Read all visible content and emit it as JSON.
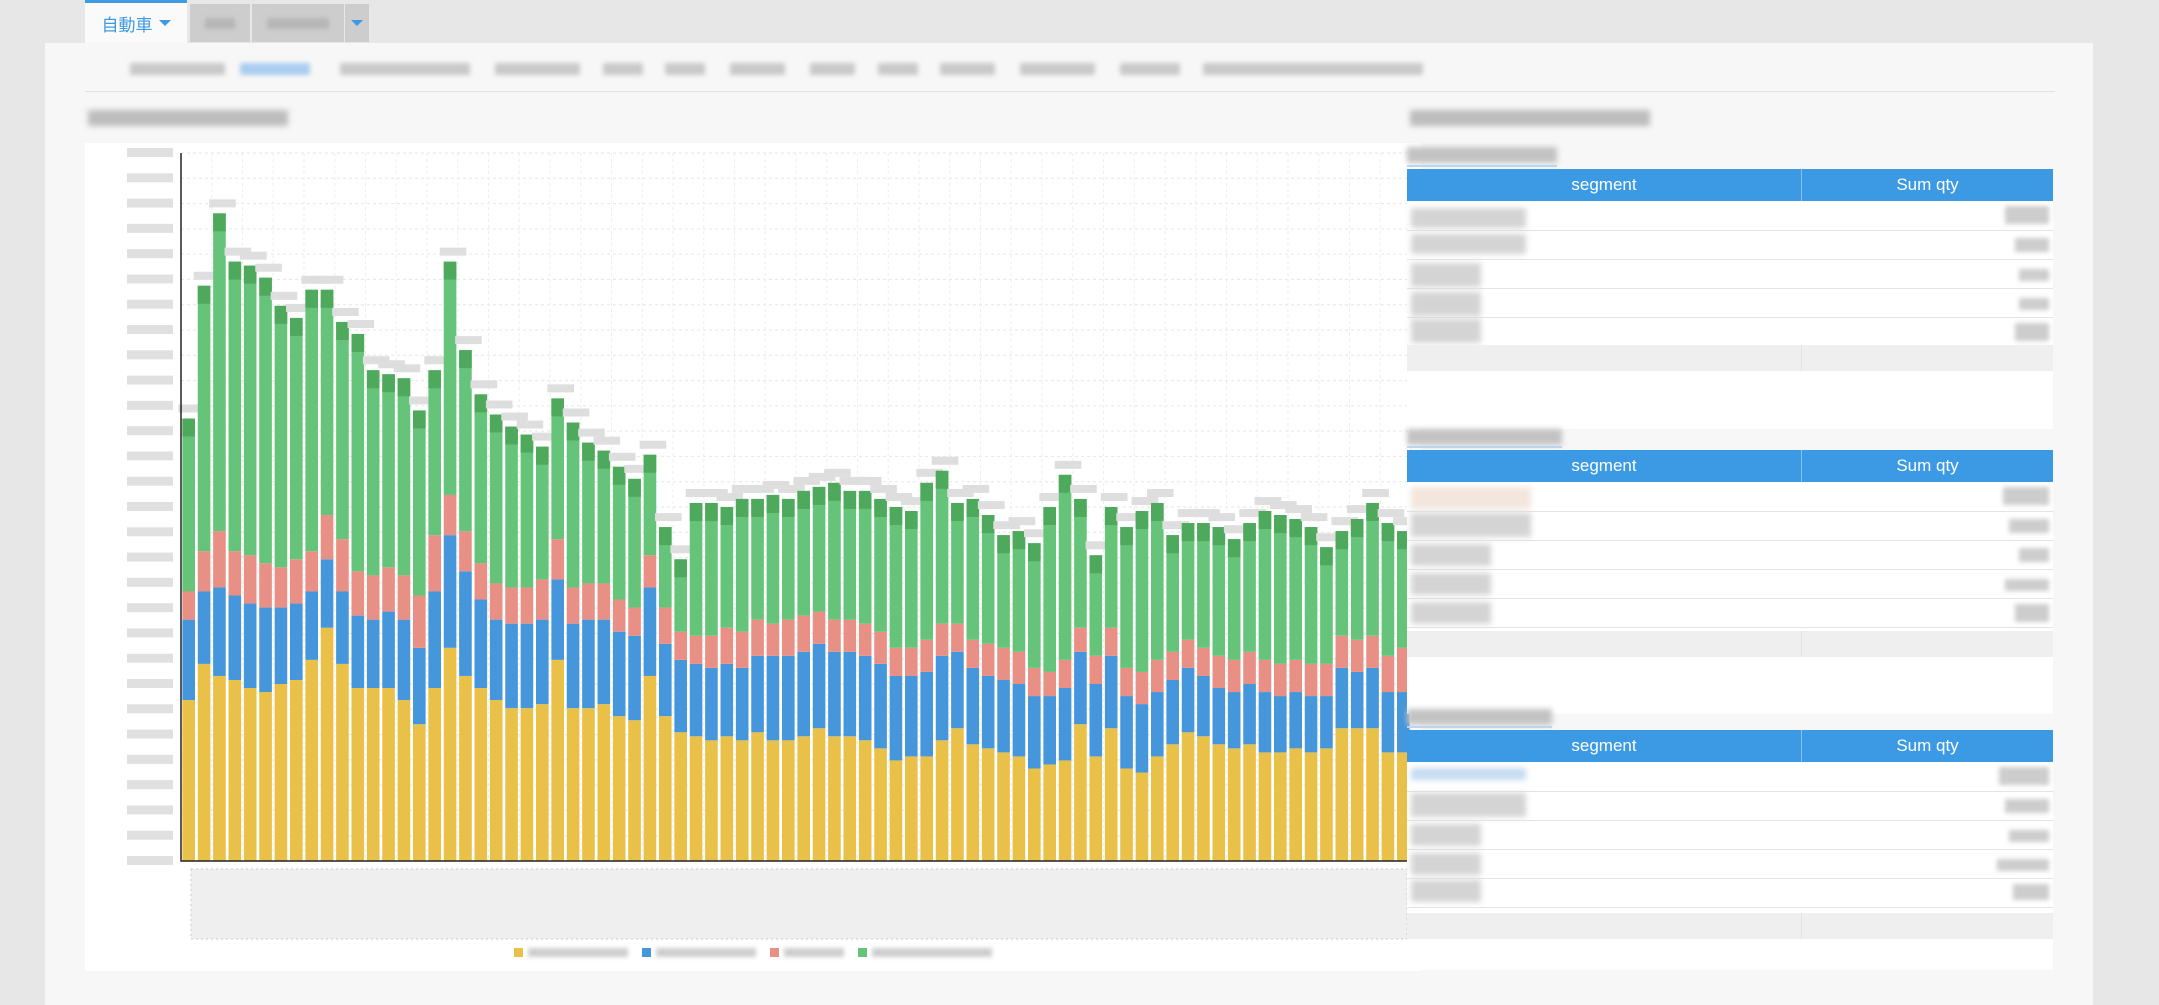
{
  "tabs": {
    "active_label": "自動車",
    "active_color": "#3f9ae3"
  },
  "side_tables": [
    {
      "col_segment": "segment",
      "col_qty": "Sum qty"
    },
    {
      "col_segment": "segment",
      "col_qty": "Sum qty"
    },
    {
      "col_segment": "segment",
      "col_qty": "Sum qty"
    }
  ],
  "chart_data": {
    "type": "bar",
    "stacked": true,
    "grid": true,
    "legend_position": "bottom",
    "series": [
      {
        "color": "#e9c148",
        "values": [
          200,
          245,
          230,
          225,
          215,
          210,
          220,
          225,
          250,
          290,
          245,
          215,
          215,
          215,
          200,
          170,
          215,
          265,
          230,
          215,
          200,
          190,
          190,
          195,
          250,
          190,
          190,
          195,
          180,
          175,
          230,
          180,
          160,
          155,
          150,
          155,
          150,
          160,
          150,
          150,
          155,
          165,
          155,
          155,
          150,
          140,
          125,
          130,
          130,
          150,
          165,
          145,
          140,
          135,
          130,
          115,
          120,
          125,
          170,
          130,
          165,
          115,
          110,
          130,
          145,
          160,
          155,
          145,
          140,
          145,
          135,
          135,
          140,
          135,
          140,
          165,
          165,
          165,
          135,
          135
        ]
      },
      {
        "color": "#4596da",
        "values": [
          100,
          90,
          110,
          105,
          105,
          105,
          95,
          95,
          85,
          85,
          90,
          90,
          85,
          95,
          100,
          95,
          120,
          140,
          130,
          110,
          100,
          105,
          105,
          105,
          100,
          105,
          110,
          105,
          105,
          105,
          110,
          90,
          90,
          90,
          90,
          90,
          90,
          95,
          105,
          105,
          105,
          105,
          105,
          105,
          105,
          105,
          105,
          100,
          105,
          105,
          95,
          95,
          90,
          90,
          90,
          90,
          85,
          90,
          90,
          90,
          90,
          90,
          85,
          80,
          80,
          80,
          75,
          70,
          70,
          75,
          75,
          70,
          70,
          70,
          65,
          75,
          70,
          75,
          75,
          75
        ]
      },
      {
        "color": "#e88f86",
        "values": [
          35,
          50,
          70,
          55,
          60,
          55,
          50,
          55,
          50,
          55,
          65,
          55,
          55,
          55,
          55,
          65,
          70,
          50,
          50,
          45,
          45,
          45,
          45,
          50,
          50,
          45,
          45,
          45,
          40,
          35,
          40,
          45,
          35,
          35,
          40,
          45,
          45,
          45,
          40,
          45,
          45,
          40,
          40,
          40,
          40,
          40,
          35,
          35,
          40,
          40,
          35,
          35,
          40,
          40,
          40,
          35,
          30,
          35,
          30,
          35,
          35,
          35,
          40,
          40,
          35,
          35,
          35,
          40,
          40,
          40,
          40,
          40,
          40,
          40,
          40,
          40,
          40,
          40,
          45,
          55
        ]
      },
      {
        "color": "#66c47a",
        "values": [
          215,
          330,
          395,
          360,
          360,
          355,
          325,
          300,
          325,
          280,
          270,
          295,
          255,
          240,
          245,
          230,
          205,
          290,
          225,
          210,
          210,
          200,
          190,
          165,
          175,
          205,
          175,
          165,
          165,
          160,
          125,
          100,
          90,
          165,
          165,
          150,
          165,
          150,
          160,
          150,
          155,
          155,
          170,
          160,
          165,
          165,
          175,
          170,
          195,
          190,
          150,
          175,
          160,
          140,
          150,
          155,
          205,
          230,
          160,
          125,
          150,
          175,
          200,
          195,
          145,
          145,
          155,
          160,
          150,
          160,
          185,
          185,
          175,
          170,
          145,
          130,
          150,
          165,
          165,
          145
        ]
      }
    ],
    "ylim": [
      0,
      880
    ]
  }
}
